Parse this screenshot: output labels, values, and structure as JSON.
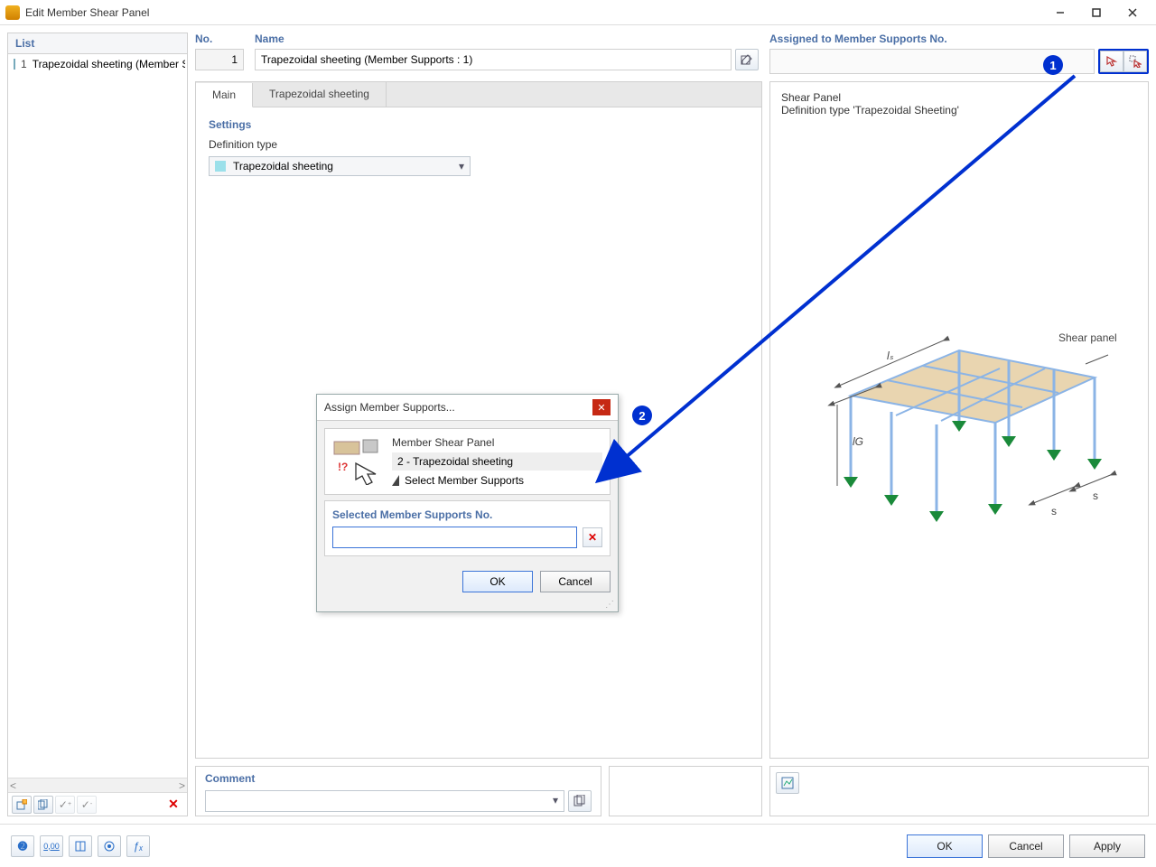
{
  "window": {
    "title": "Edit Member Shear Panel"
  },
  "left": {
    "header": "List",
    "items": [
      {
        "num": "1",
        "label": "Trapezoidal sheeting (Member S"
      }
    ]
  },
  "top": {
    "no_label": "No.",
    "no_value": "1",
    "name_label": "Name",
    "name_value": "Trapezoidal sheeting (Member Supports : 1)",
    "assigned_label": "Assigned to Member Supports No.",
    "assigned_value": ""
  },
  "tabs": {
    "main": "Main",
    "trap": "Trapezoidal sheeting",
    "settings_title": "Settings",
    "deftype_label": "Definition type",
    "deftype_value": "Trapezoidal sheeting"
  },
  "preview": {
    "title": "Shear Panel",
    "subtitle": "Definition type 'Trapezoidal Sheeting'",
    "caption_shear_panel": "Shear panel",
    "label_ls": "lₛ",
    "label_lg": "lG",
    "label_s1": "s",
    "label_s2": "s"
  },
  "comment": {
    "label": "Comment",
    "value": ""
  },
  "footer": {
    "ok": "OK",
    "cancel": "Cancel",
    "apply": "Apply"
  },
  "assign_dialog": {
    "title": "Assign Member Supports...",
    "line1": "Member Shear Panel",
    "line2": "2 - Trapezoidal sheeting",
    "line3": "Select Member Supports",
    "selected_label": "Selected Member Supports No.",
    "selected_value": "",
    "ok": "OK",
    "cancel": "Cancel"
  },
  "callouts": {
    "one": "1",
    "two": "2"
  }
}
